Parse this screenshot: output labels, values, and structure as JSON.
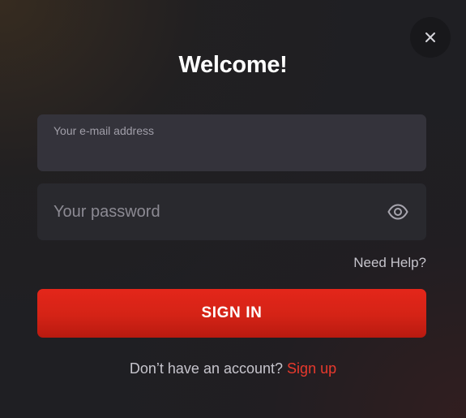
{
  "dialog": {
    "title": "Welcome!",
    "close_icon": "close-icon"
  },
  "email": {
    "label": "Your e-mail address",
    "value": ""
  },
  "password": {
    "placeholder": "Your password",
    "value": "",
    "toggle_icon": "eye-icon"
  },
  "help": {
    "label": "Need Help?"
  },
  "signin": {
    "label": "SIGN IN",
    "color": "#d42316"
  },
  "signup": {
    "prompt": "Don’t have an account?",
    "link_label": "Sign up",
    "link_color": "#e8392d"
  }
}
